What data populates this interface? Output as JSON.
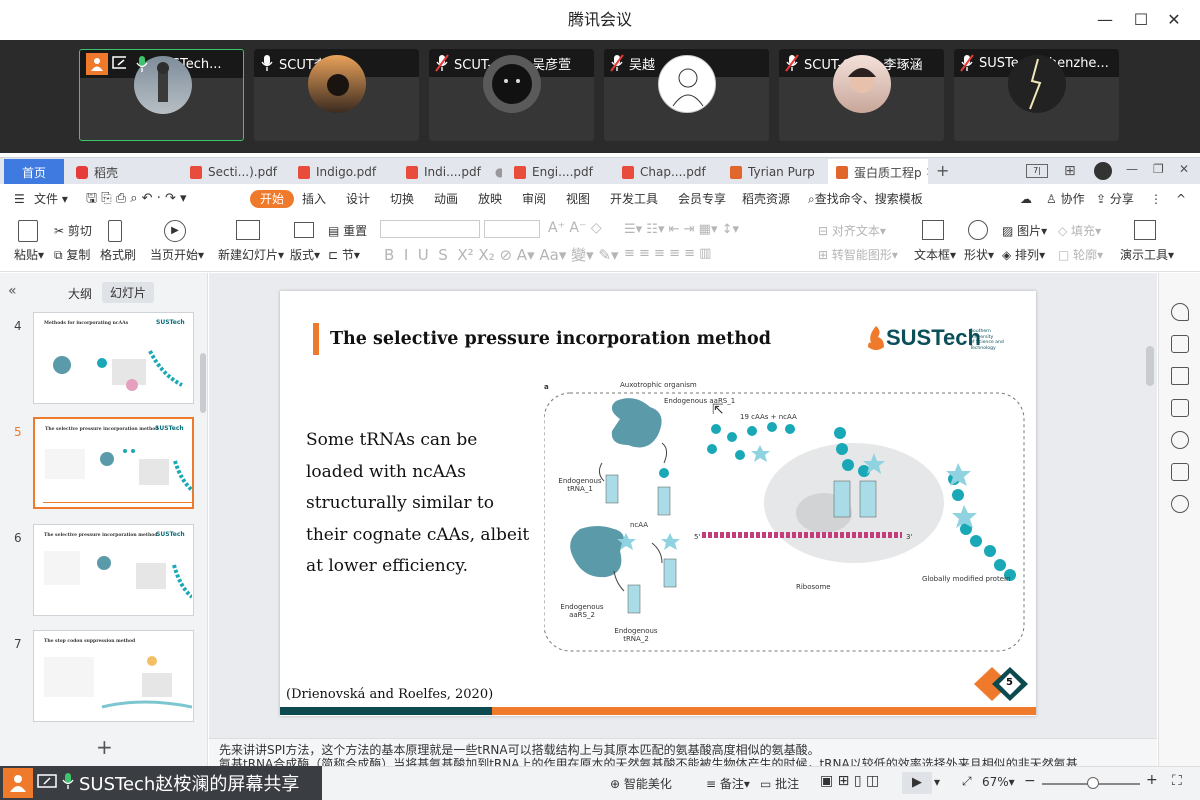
{
  "window": {
    "title": "腾讯会议"
  },
  "participants": [
    {
      "name": "SUSTech...",
      "mic": "on",
      "sharing": true
    },
    {
      "name": "SCUT李函临",
      "mic": "on",
      "sharing": false
    },
    {
      "name": "SCUT-china-吴彦萱",
      "mic": "muted",
      "sharing": false
    },
    {
      "name": "吴越",
      "mic": "muted",
      "sharing": false
    },
    {
      "name": "SCUT-China 李琢涵",
      "mic": "muted",
      "sharing": false
    },
    {
      "name": "SUSTech_Shenzhe...",
      "mic": "muted",
      "sharing": false
    }
  ],
  "doc_tabs": [
    {
      "label": "首页"
    },
    {
      "label": "稻壳"
    },
    {
      "label": "Secti...).pdf"
    },
    {
      "label": "Indigo.pdf"
    },
    {
      "label": "Indi....pdf"
    },
    {
      "label": "Engi....pdf"
    },
    {
      "label": "Chap....pdf"
    },
    {
      "label": "Tyrian Purp"
    },
    {
      "label": "蛋白质工程p"
    }
  ],
  "menu": {
    "file": "文件",
    "items": [
      "开始",
      "插入",
      "设计",
      "切换",
      "动画",
      "放映",
      "审阅",
      "视图",
      "开发工具",
      "会员专享",
      "稻壳资源"
    ],
    "search": "查找命令、搜索模板",
    "collab": "协作",
    "share": "分享"
  },
  "ribbon": {
    "paste": "粘贴",
    "cut": "剪切",
    "copy": "复制",
    "format_painter": "格式刷",
    "start_from_current": "当页开始",
    "new_slide": "新建幻灯片",
    "layout": "版式",
    "reset": "重置",
    "section": "节",
    "align_text": "对齐文本",
    "smartart": "转智能图形",
    "textbox": "文本框",
    "shape": "形状",
    "picture": "图片",
    "arrange": "排列",
    "fill": "填充",
    "outline": "轮廓",
    "present_tools": "演示工具"
  },
  "panel": {
    "tab_outline": "大纲",
    "tab_slides": "幻灯片",
    "thumb_numbers": [
      "4",
      "5",
      "6",
      "7"
    ],
    "thumb_titles": [
      "Methods for incorporating ncAAs",
      "The selective pressure incorporation method",
      "The selective pressure incorporation method",
      "The stop codon suppression method"
    ],
    "add": "+"
  },
  "slide": {
    "title": "The selective pressure incorporation method",
    "body": "Some tRNAs can be loaded with ncAAs structurally similar to their cognate cAAs, albeit at lower efficiency.",
    "citation": "(Drienovská and Roelfes, 2020)",
    "logo_text": "SUSTech",
    "logo_sub1": "Southern University",
    "logo_sub2": "of Science and",
    "logo_sub3": "Technology",
    "page_number": "5",
    "figure": {
      "panel": "a",
      "organism": "Auxotrophic organism",
      "aars1": "Endogenous aaRS_1",
      "caas": "19 cAAs + ncAA",
      "trna1": "Endogenous tRNA_1",
      "ncaa": "ncAA",
      "aars2": "Endogenous aaRS_2",
      "trna2": "Endogenous tRNA_2",
      "ribosome": "Ribosome",
      "protein": "Globally modified protein",
      "five": "5'",
      "three": "3'"
    }
  },
  "notes": {
    "line1": "先来讲讲SPI方法，这个方法的基本原理就是一些tRNA可以搭载结构上与其原本匹配的氨基酸高度相似的氨基酸。",
    "line2": "氨基tRNA合成酶（简称合成酶）当将基氨基酸加到tRNA上的作用在原本的天然氨基酸不能被生物体产生的时候，tRNA以较低的效率选择外来且相似的非天然氨基"
  },
  "status": {
    "share_banner": "SUSTech赵桉澜的屏幕共享",
    "smart": "智能美化",
    "notes_btn": "备注",
    "comment": "批注",
    "zoom": "67%",
    "zoom_fraction": 0.52
  }
}
